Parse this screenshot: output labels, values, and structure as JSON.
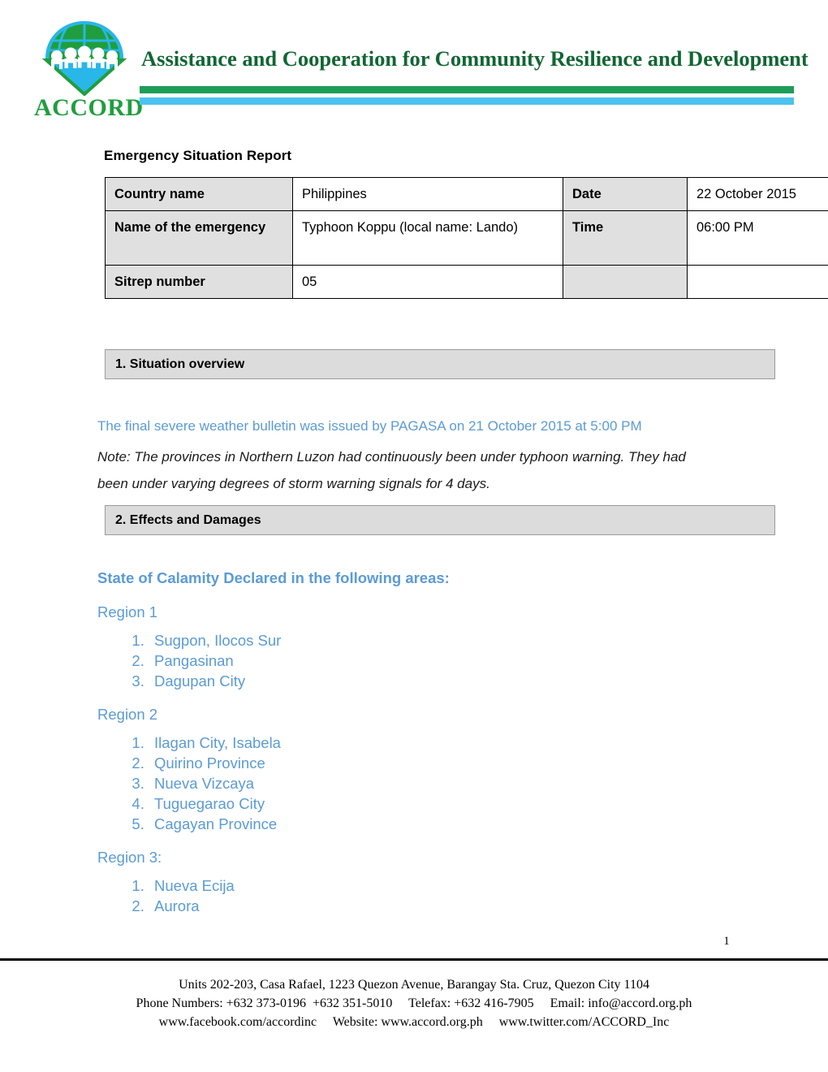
{
  "letterhead": {
    "logo_icon": "accord-globe-people-logo",
    "wordmark": "ACCORD",
    "org_title": "Assistance and Cooperation for Community Resilience and Development",
    "rule_green_color": "#1d9e58",
    "rule_blue_color": "#4cc3ee",
    "title_color": "#116633",
    "wordmark_color": "#1f9e3d"
  },
  "document": {
    "report_title": "Emergency Situation Report",
    "accent_blue": "#5b9bd5",
    "table_label_fill": "#e0e0e0",
    "section_bar_fill": "#dcdcdc"
  },
  "info_table": {
    "rows": [
      {
        "label": "Country name",
        "value": "Philippines",
        "label2": "Date",
        "value2": "22 October 2015"
      },
      {
        "label": "Name of the emergency",
        "value": "Typhoon Koppu (local name: Lando)",
        "label2": "Time",
        "value2": "06:00 PM"
      },
      {
        "label": "Sitrep number",
        "value": "05",
        "label2": "",
        "value2": ""
      }
    ]
  },
  "sections": {
    "situation_overview": {
      "heading": "1. Situation overview",
      "bulletin_line": "The final severe weather bulletin was issued by PAGASA on 21 October 2015 at 5:00 PM",
      "note": "Note: The provinces in Northern Luzon had continuously been under typhoon warning. They had been under varying degrees of storm warning signals for 4 days."
    },
    "effects_and_damages": {
      "heading": "2. Effects and Damages",
      "calamity_heading": "State of Calamity Declared in the following areas:",
      "regions": [
        {
          "label": "Region 1",
          "items": [
            "Sugpon, Ilocos Sur",
            "Pangasinan",
            "Dagupan City"
          ]
        },
        {
          "label": "Region 2",
          "items": [
            "Ilagan City, Isabela",
            "Quirino Province",
            "Nueva Vizcaya",
            "Tuguegarao City",
            "Cagayan Province"
          ]
        },
        {
          "label": "Region 3:",
          "items": [
            "Nueva Ecija",
            "Aurora"
          ]
        }
      ]
    }
  },
  "footer": {
    "page_number": "1",
    "line1": "Units 202-203, Casa Rafael, 1223 Quezon Avenue, Barangay Sta. Cruz, Quezon City 1104",
    "line2": "Phone Numbers: +632 373-0196  +632 351-5010     Telefax: +632 416-7905     Email: info@accord.org.ph",
    "line3": "www.facebook.com/accordinc     Website: www.accord.org.ph     www.twitter.com/ACCORD_Inc"
  }
}
